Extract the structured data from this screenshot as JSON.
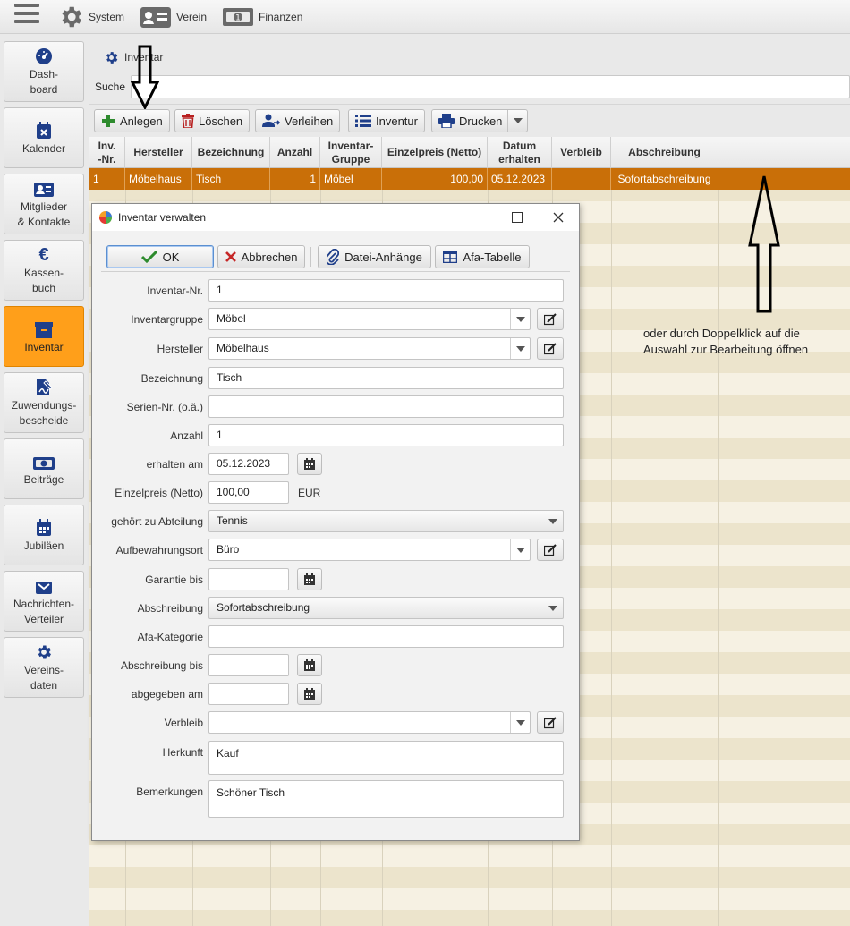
{
  "topbar": {
    "menu": [
      {
        "label": "System",
        "icon": "gear-icon"
      },
      {
        "label": "Verein",
        "icon": "id-card-icon"
      },
      {
        "label": "Finanzen",
        "icon": "money-icon"
      }
    ]
  },
  "sidenav": {
    "items": [
      {
        "label": "Dash-\nboard",
        "icon": "dashboard-icon"
      },
      {
        "label": "Kalender",
        "icon": "calendar-icon"
      },
      {
        "label": "Mitglieder\n& Kontakte",
        "icon": "contacts-icon"
      },
      {
        "label": "Kassen-\nbuch",
        "icon": "euro-icon"
      },
      {
        "label": "Inventar",
        "icon": "archive-icon",
        "active": true
      },
      {
        "label": "Zuwendungs-\nbescheide",
        "icon": "signature-icon"
      },
      {
        "label": "Beiträge",
        "icon": "money-icon"
      },
      {
        "label": "Jubiläen",
        "icon": "calendar-icon"
      },
      {
        "label": "Nachrichten-\nVerteiler",
        "icon": "envelope-icon"
      },
      {
        "label": "Vereins-\ndaten",
        "icon": "gear-icon"
      }
    ]
  },
  "tab": {
    "label": "Inventar",
    "icon": "gear-icon"
  },
  "search": {
    "label": "Suche",
    "value": ""
  },
  "toolbar": {
    "anlegen": "Anlegen",
    "loeschen": "Löschen",
    "verleihen": "Verleihen",
    "inventur": "Inventur",
    "drucken": "Drucken"
  },
  "table": {
    "columns": [
      "Inv.\n-Nr.",
      "Hersteller",
      "Bezeichnung",
      "Anzahl",
      "Inventar-\nGruppe",
      "Einzelpreis (Netto)",
      "Datum\nerhalten",
      "Verbleib",
      "Abschreibung"
    ],
    "rows": [
      [
        "1",
        "Möbelhaus",
        "Tisch",
        "1",
        "Möbel",
        "100,00",
        "05.12.2023",
        "",
        "Sofortabschreibung"
      ]
    ]
  },
  "annotation": {
    "text_line1": "oder durch Doppelklick auf die",
    "text_line2": "Auswahl zur Bearbeitung öffnen"
  },
  "dialog": {
    "title": "Inventar verwalten",
    "buttons": {
      "ok": "OK",
      "abbrechen": "Abbrechen",
      "anhaenge": "Datei-Anhänge",
      "afa": "Afa-Tabelle"
    },
    "fields": {
      "inventar_nr": {
        "label": "Inventar-Nr.",
        "value": "1"
      },
      "inventargruppe": {
        "label": "Inventargruppe",
        "value": "Möbel"
      },
      "hersteller": {
        "label": "Hersteller",
        "value": "Möbelhaus"
      },
      "bezeichnung": {
        "label": "Bezeichnung",
        "value": "Tisch"
      },
      "seriennr": {
        "label": "Serien-Nr. (o.ä.)",
        "value": ""
      },
      "anzahl": {
        "label": "Anzahl",
        "value": "1"
      },
      "erhalten_am": {
        "label": "erhalten am",
        "value": "05.12.2023"
      },
      "einzelpreis": {
        "label": "Einzelpreis (Netto)",
        "value": "100,00",
        "unit": "EUR"
      },
      "abteilung": {
        "label": "gehört zu Abteilung",
        "value": "Tennis"
      },
      "aufbewahrungsort": {
        "label": "Aufbewahrungsort",
        "value": "Büro"
      },
      "garantie_bis": {
        "label": "Garantie bis",
        "value": ""
      },
      "abschreibung": {
        "label": "Abschreibung",
        "value": "Sofortabschreibung"
      },
      "afa_kategorie": {
        "label": "Afa-Kategorie",
        "value": ""
      },
      "abschreibung_bis": {
        "label": "Abschreibung bis",
        "value": ""
      },
      "abgegeben_am": {
        "label": "abgegeben am",
        "value": ""
      },
      "verbleib": {
        "label": "Verbleib",
        "value": ""
      },
      "herkunft": {
        "label": "Herkunft",
        "value": "Kauf"
      },
      "bemerkungen": {
        "label": "Bemerkungen",
        "value": "Schöner Tisch"
      }
    }
  },
  "colors": {
    "accent_orange": "#ff9f1a",
    "selection": "#c96f08",
    "row_stripe_a": "#ece4cc",
    "row_stripe_b": "#f6f1e3",
    "icon_blue": "#1f3f8a"
  }
}
